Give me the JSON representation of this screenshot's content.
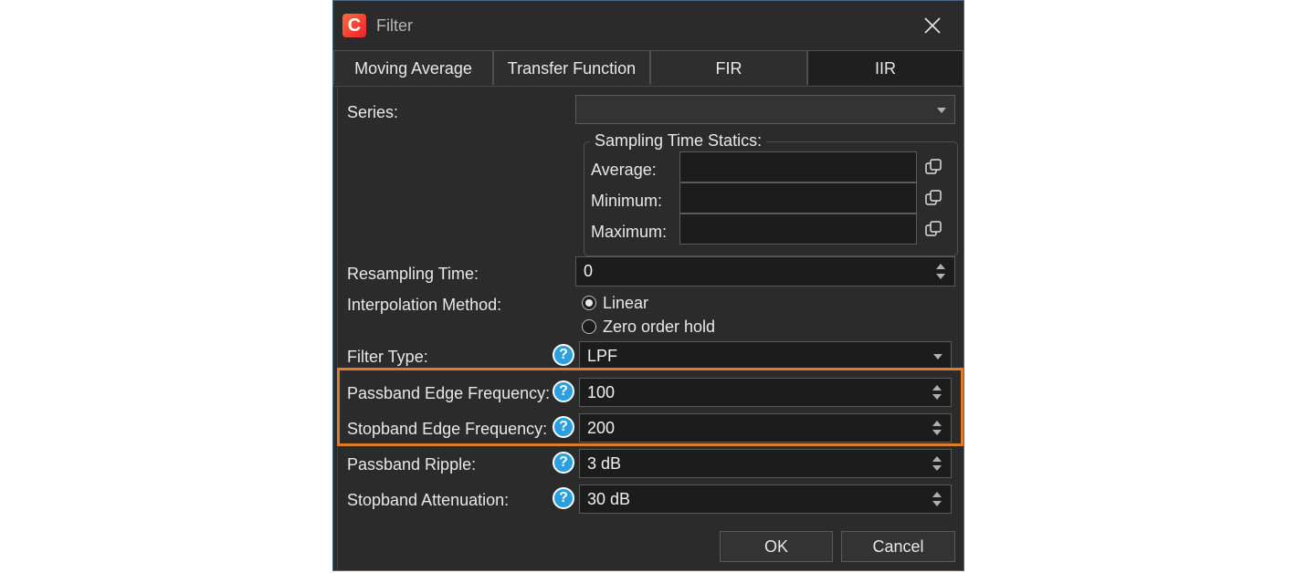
{
  "window": {
    "title": "Filter",
    "app_icon_letter": "C"
  },
  "tabs": [
    {
      "label": "Moving Average",
      "active": false
    },
    {
      "label": "Transfer Function",
      "active": false
    },
    {
      "label": "FIR",
      "active": false
    },
    {
      "label": "IIR",
      "active": true
    }
  ],
  "form": {
    "series": {
      "label": "Series:",
      "value": ""
    },
    "sampling_stats": {
      "title": "Sampling Time Statics:",
      "average": {
        "label": "Average:",
        "value": ""
      },
      "minimum": {
        "label": "Minimum:",
        "value": ""
      },
      "maximum": {
        "label": "Maximum:",
        "value": ""
      }
    },
    "resampling_time": {
      "label": "Resampling Time:",
      "value": "0"
    },
    "interpolation": {
      "label": "Interpolation Method:",
      "options": [
        {
          "label": "Linear",
          "selected": true
        },
        {
          "label": "Zero order hold",
          "selected": false
        }
      ]
    },
    "filter_type": {
      "label": "Filter Type:",
      "value": "LPF"
    },
    "passband_edge": {
      "label": "Passband Edge Frequency:",
      "value": "100"
    },
    "stopband_edge": {
      "label": "Stopband Edge Frequency:",
      "value": "200"
    },
    "passband_ripple": {
      "label": "Passband Ripple:",
      "value": "3 dB"
    },
    "stopband_attenuation": {
      "label": "Stopband Attenuation:",
      "value": "30 dB"
    },
    "help_glyph": "?"
  },
  "buttons": {
    "ok": "OK",
    "cancel": "Cancel"
  },
  "colors": {
    "background": "#2b2b2b",
    "highlight": "#e07b2a",
    "help": "#2aa0e0",
    "field": "#1c1c1c"
  },
  "icons": {
    "close": "close-icon",
    "copy": "copy-icon",
    "help": "help-icon",
    "app": "app-logo-icon"
  }
}
